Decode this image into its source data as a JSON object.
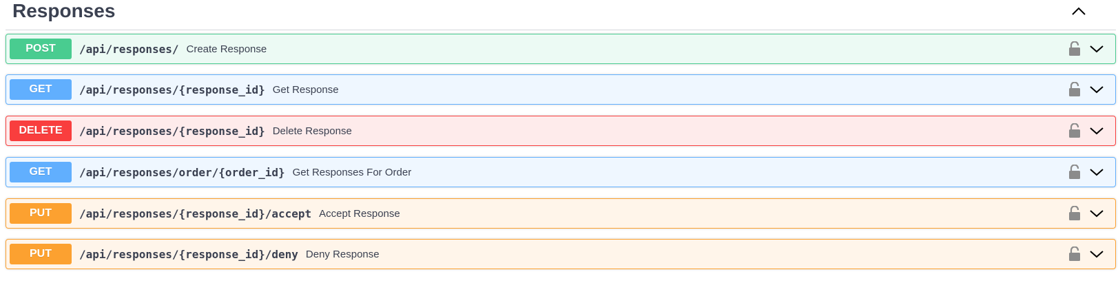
{
  "section": {
    "title": "Responses",
    "toggle_icon": "chevron-up-icon"
  },
  "operations": [
    {
      "method": "POST",
      "path": "/api/responses/",
      "summary": "Create Response",
      "color": "#49cc90"
    },
    {
      "method": "GET",
      "path": "/api/responses/{response_id}",
      "summary": "Get Response",
      "color": "#61affe"
    },
    {
      "method": "DELETE",
      "path": "/api/responses/{response_id}",
      "summary": "Delete Response",
      "color": "#f93e3e"
    },
    {
      "method": "GET",
      "path": "/api/responses/order/{order_id}",
      "summary": "Get Responses For Order",
      "color": "#61affe"
    },
    {
      "method": "PUT",
      "path": "/api/responses/{response_id}/accept",
      "summary": "Accept Response",
      "color": "#fca130"
    },
    {
      "method": "PUT",
      "path": "/api/responses/{response_id}/deny",
      "summary": "Deny Response",
      "color": "#fca130"
    }
  ],
  "icons": {
    "lock": "unlocked-padlock-icon",
    "expand": "chevron-down-icon"
  }
}
